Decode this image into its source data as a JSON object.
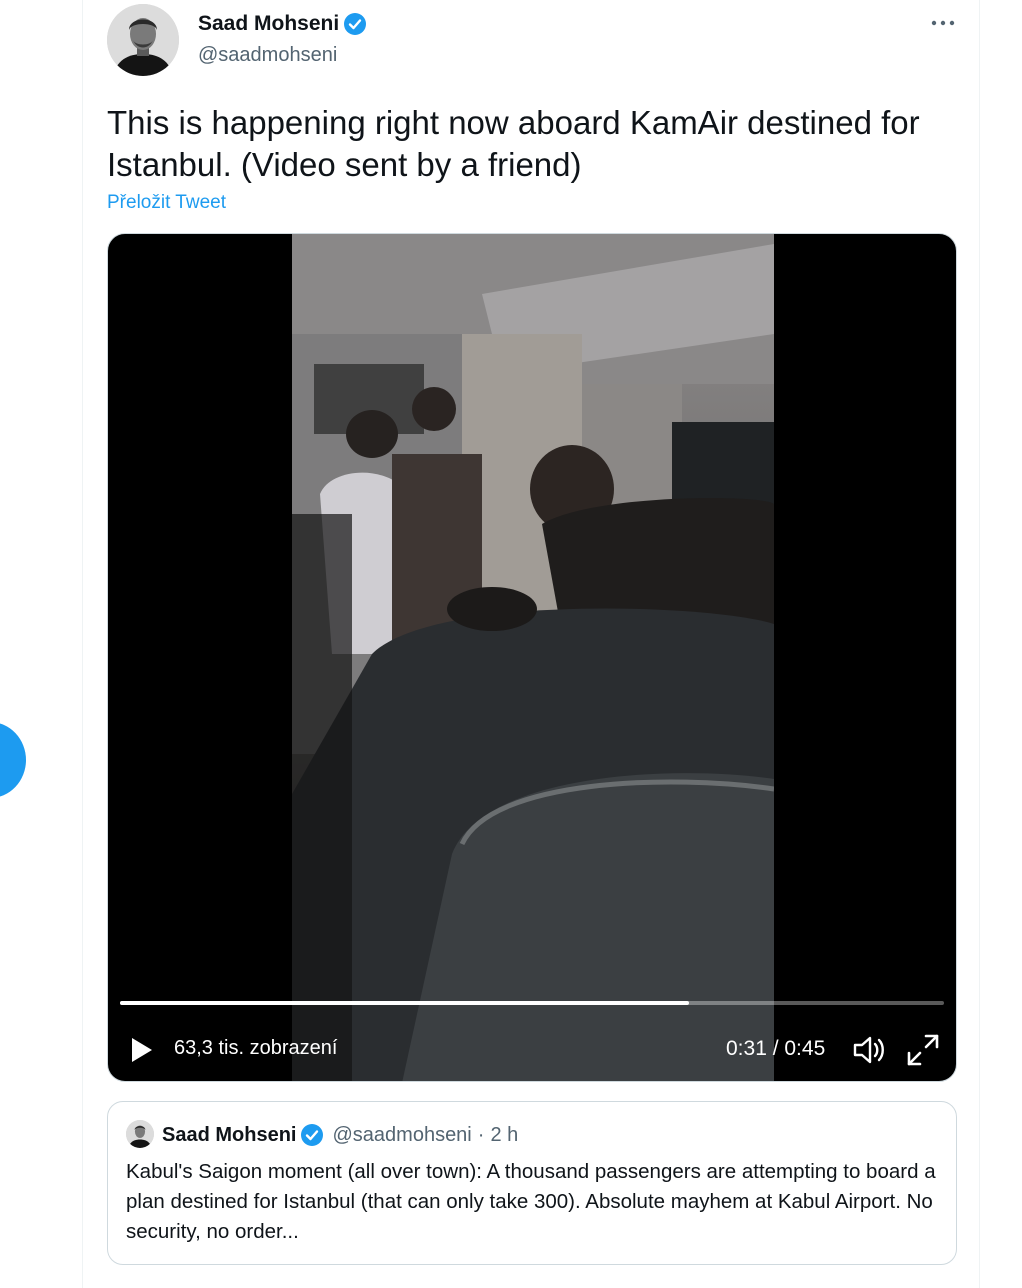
{
  "author": {
    "name": "Saad Mohseni",
    "handle": "@saadmohseni",
    "avatar_icon": "person-portrait-avatar",
    "verified_icon": "verified-badge-icon"
  },
  "more_icon": "more-horizontal-icon",
  "tweet": {
    "text": "This is happening right now aboard KamAir destined for Istanbul. (Video sent by a friend)",
    "translate_label": "Přeložit Tweet"
  },
  "video": {
    "views": "63,3 tis. zobrazení",
    "time": "0:31 / 0:45",
    "progress": 0.69,
    "play_icon": "play-icon",
    "volume_icon": "volume-icon",
    "fullscreen_icon": "fullscreen-icon"
  },
  "quote": {
    "name": "Saad Mohseni",
    "handle": "@saadmohseni",
    "separator": "·",
    "time": "2 h",
    "text": "Kabul's Saigon moment (all over town): A thousand passengers are attempting to board a plan destined for Istanbul (that can only take 300).  Absolute mayhem at Kabul Airport. No security, no order..."
  },
  "colors": {
    "accent": "#1d9bf0",
    "text": "#0f1419",
    "secondary": "#536471",
    "border": "#cfd9de"
  }
}
